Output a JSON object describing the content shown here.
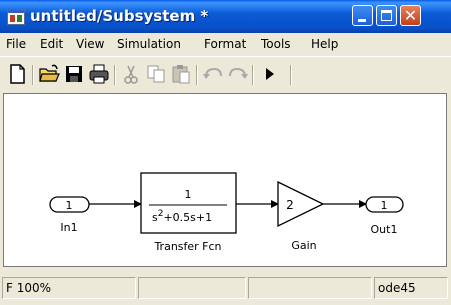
{
  "window": {
    "title": "untitled/Subsystem *"
  },
  "menu": [
    "File",
    "Edit",
    "View",
    "Simulation",
    "Format",
    "Tools",
    "Help"
  ],
  "model": {
    "in_port": {
      "number": "1",
      "label": "In1"
    },
    "transfer_fcn": {
      "numerator": "1",
      "denominator_prefix": "s",
      "denominator_exp": "2",
      "denominator_rest": "+0.5s+1",
      "label": "Transfer Fcn"
    },
    "gain": {
      "value": "2",
      "label": "Gain"
    },
    "out_port": {
      "number": "1",
      "label": "Out1"
    }
  },
  "status": {
    "prefix": "F",
    "zoom": "100%",
    "solver": "ode45"
  },
  "icons": [
    "new-model-icon",
    "open-icon",
    "save-icon",
    "print-icon",
    "cut-icon",
    "copy-icon",
    "paste-icon",
    "undo-icon",
    "redo-icon",
    "start-simulation-icon"
  ],
  "colors": {
    "title_bar": "#0b5bd6",
    "close_button": "#c0401a",
    "canvas": "#ffffff"
  }
}
